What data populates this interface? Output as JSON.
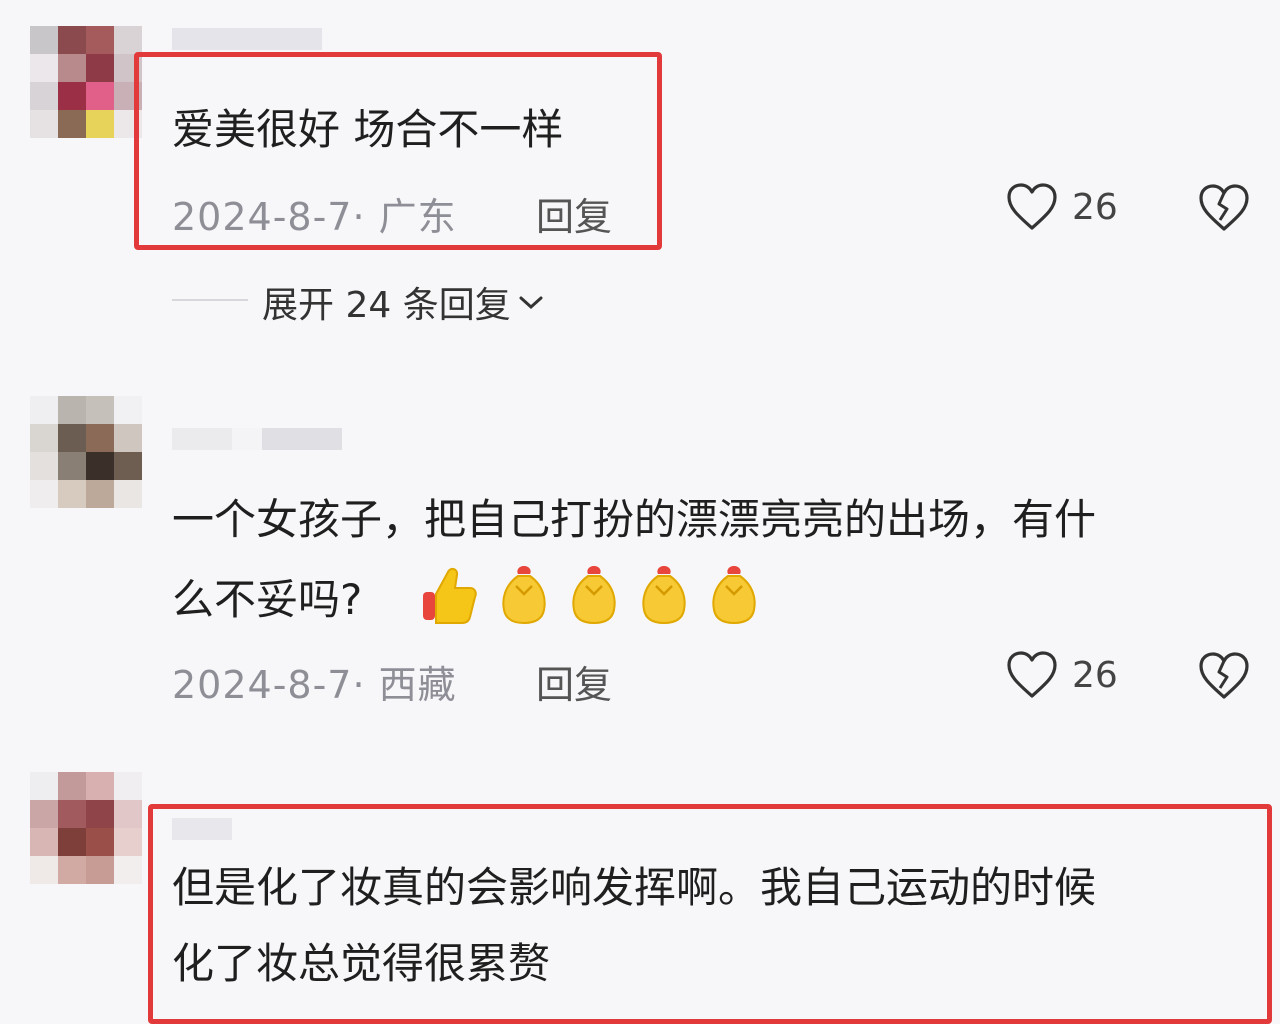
{
  "comments": [
    {
      "text_line1": "爱美很好 场合不一样",
      "date_region": "2024-8-7· 广东",
      "reply_label": "回复",
      "likes": "26",
      "expand_label": "展开 24 条回复"
    },
    {
      "text_line1": "一个女孩子，把自己打扮的漂漂亮亮的出场，有什",
      "text_line2": "么不妥吗?",
      "date_region": "2024-8-7· 西藏",
      "reply_label": "回复",
      "likes": "26"
    },
    {
      "text_line1": "但是化了妆真的会影响发挥啊。我自己运动的时候",
      "text_line2": "化了妆总觉得很累赘"
    }
  ],
  "colors": {
    "highlight": "#e23a3a",
    "meta": "#8e8e96"
  },
  "icons": {
    "like": "heart-outline-icon",
    "dislike": "broken-heart-icon",
    "expand": "chevron-down-icon"
  }
}
